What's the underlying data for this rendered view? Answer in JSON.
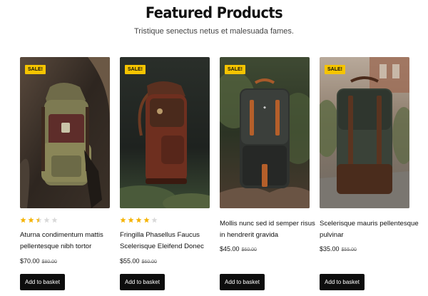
{
  "header": {
    "title": "Featured Products",
    "subtitle": "Tristique senectus netus et malesuada fames."
  },
  "colors": {
    "sale_badge": "#f5c400",
    "star_filled": "#f5b301",
    "star_empty": "#d9d9d9",
    "button": "#0d0d0d"
  },
  "products": [
    {
      "badge": "SALE!",
      "rating": 2.5,
      "name": "Aturna condimentum mattis pellentesque nibh tortor",
      "price": "$70.00",
      "old_price": "$80.00",
      "button": "Add to basket"
    },
    {
      "badge": "SALE!",
      "rating": 4,
      "name": "Fringilla Phasellus Faucus Scelerisque Eleifend Donec",
      "price": "$55.00",
      "old_price": "$60.00",
      "button": "Add to basket"
    },
    {
      "badge": "SALE!",
      "rating": 0,
      "name": "Mollis nunc sed id semper risus in hendrerit gravida",
      "price": "$45.00",
      "old_price": "$60.00",
      "button": "Add to basket"
    },
    {
      "badge": "SALE!",
      "rating": 0,
      "name": "Scelerisque mauris pellentesque pulvinar",
      "price": "$35.00",
      "old_price": "$55.00",
      "button": "Add to basket"
    }
  ]
}
